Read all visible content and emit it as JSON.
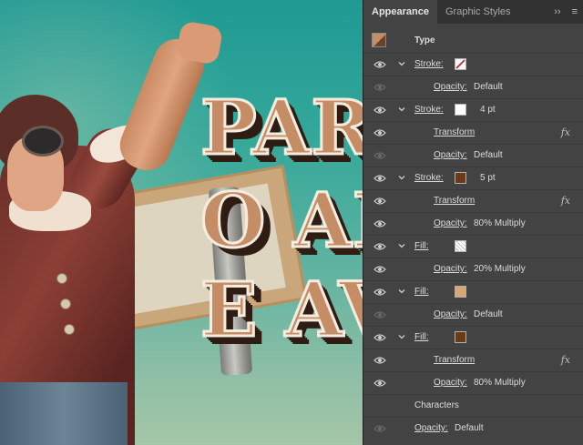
{
  "panel": {
    "tabs": [
      "Appearance",
      "Graphic Styles"
    ],
    "menu_glyphs": [
      "››",
      "≡"
    ],
    "header": {
      "label": "Type"
    },
    "rows": [
      {
        "kind": "attr",
        "eye": true,
        "chevron": true,
        "label": "Stroke:",
        "swatch": "none",
        "value": ""
      },
      {
        "kind": "opacity",
        "eye": false,
        "label": "Opacity:",
        "value": "Default"
      },
      {
        "kind": "attr",
        "eye": true,
        "chevron": true,
        "label": "Stroke:",
        "swatch": "#ffffff",
        "value": "4 pt"
      },
      {
        "kind": "effect",
        "eye": true,
        "label": "Transform",
        "fx": "fx"
      },
      {
        "kind": "opacity",
        "eye": false,
        "label": "Opacity:",
        "value": "Default"
      },
      {
        "kind": "attr",
        "eye": true,
        "chevron": true,
        "label": "Stroke:",
        "swatch": "#6a3a1c",
        "value": "5 pt"
      },
      {
        "kind": "effect",
        "eye": true,
        "label": "Transform",
        "fx": "fx"
      },
      {
        "kind": "opacity",
        "eye": true,
        "label": "Opacity:",
        "value": "80% Multiply"
      },
      {
        "kind": "attr",
        "eye": true,
        "chevron": true,
        "label": "Fill:",
        "swatch": "pattern",
        "value": ""
      },
      {
        "kind": "opacity",
        "eye": true,
        "label": "Opacity:",
        "value": "20% Multiply"
      },
      {
        "kind": "attr",
        "eye": true,
        "chevron": true,
        "label": "Fill:",
        "swatch": "#d6a877",
        "value": ""
      },
      {
        "kind": "opacity",
        "eye": false,
        "label": "Opacity:",
        "value": "Default"
      },
      {
        "kind": "attr",
        "eye": true,
        "chevron": true,
        "label": "Fill:",
        "swatch": "#6a3a1c",
        "value": ""
      },
      {
        "kind": "effect",
        "eye": true,
        "label": "Transform",
        "fx": "fx"
      },
      {
        "kind": "opacity",
        "eye": true,
        "label": "Opacity:",
        "value": "80% Multiply"
      },
      {
        "kind": "plain",
        "eye": null,
        "label": "Characters"
      },
      {
        "kind": "opacity",
        "eye": false,
        "label": "Opacity:",
        "value": "Default",
        "indent": "left"
      }
    ]
  },
  "canvas": {
    "text_lines": [
      "PAR",
      "O AL",
      "E AV"
    ]
  },
  "colors": {
    "panel_bg": "#434343",
    "tabbar_bg": "#323232",
    "text_fill": "#c58d65",
    "text_shadow": "#2f1d14"
  }
}
